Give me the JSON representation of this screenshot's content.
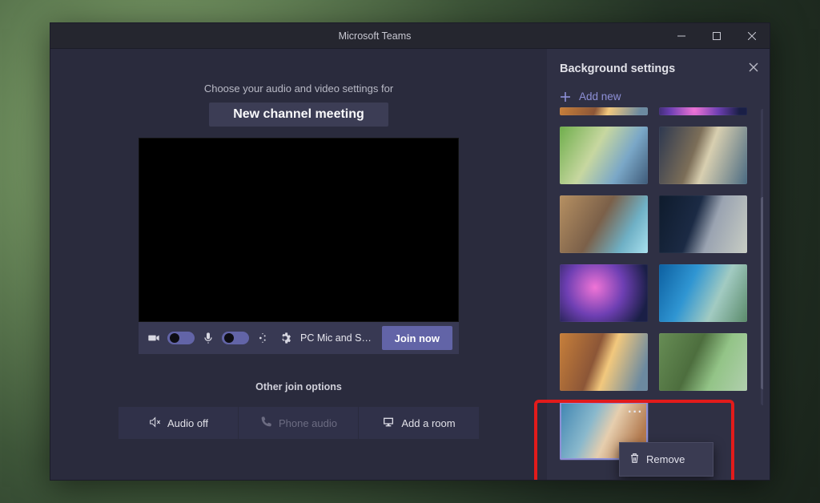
{
  "window": {
    "title": "Microsoft Teams"
  },
  "main": {
    "settings_hint": "Choose your audio and video settings for",
    "meeting_name": "New channel meeting",
    "device_label": "PC Mic and Sp…",
    "join_label": "Join now",
    "other_label": "Other join options",
    "option_audio_off": "Audio off",
    "option_phone_audio": "Phone audio",
    "option_add_room": "Add a room"
  },
  "side": {
    "title": "Background settings",
    "add_new": "Add new",
    "context_remove": "Remove"
  }
}
